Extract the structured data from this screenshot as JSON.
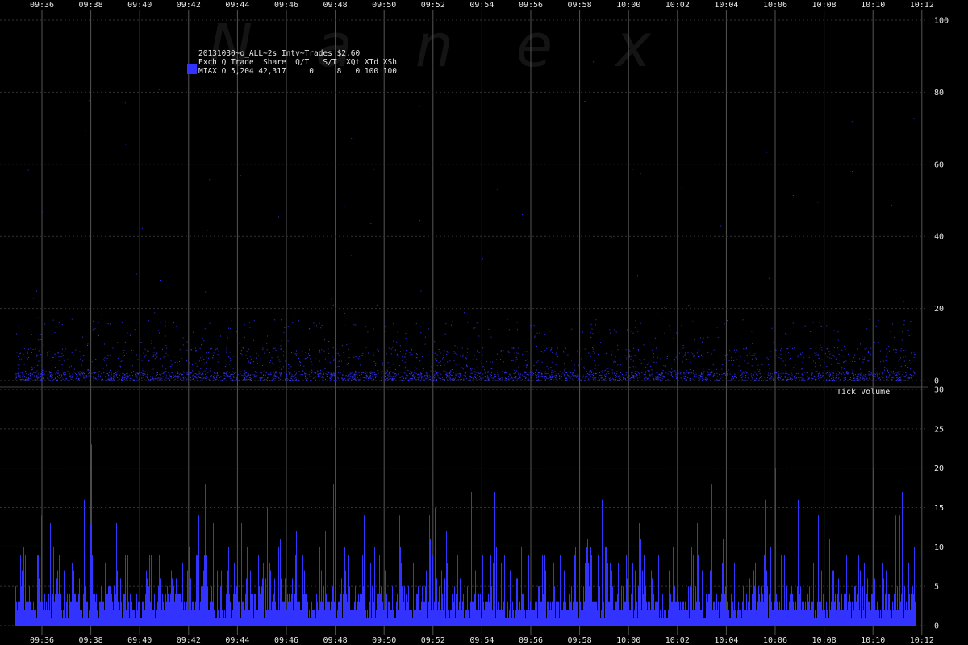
{
  "watermark": "Nanex",
  "legend": {
    "title": "20131030~o_ALL~2s Intv~Trades $2.60",
    "header": "Exch Q Trade  Share  Q/T   S/T  XQt XTd XSh",
    "row": "MIAX O 5,204 42,317     0     8   0 100 100",
    "swatch_color": "#3333ff"
  },
  "colors": {
    "background": "#000000",
    "series": "#3333ff",
    "grid_vertical": "#555555",
    "grid_horizontal": "#333333"
  },
  "chart_data": [
    {
      "type": "scatter",
      "name": "upper-panel",
      "x_ticks": [
        "09:36",
        "09:38",
        "09:40",
        "09:42",
        "09:44",
        "09:46",
        "09:48",
        "09:50",
        "09:52",
        "09:54",
        "09:56",
        "09:58",
        "10:00",
        "10:02",
        "10:04",
        "10:06",
        "10:08",
        "10:10",
        "10:12"
      ],
      "y_ticks": [
        0,
        20,
        40,
        60,
        80,
        100
      ],
      "ylim": [
        0,
        100
      ],
      "series": [
        {
          "color": "#3333ff",
          "profile": "dense points between 0 and ~15, sparse outliers up to ~90",
          "x_range": [
            "09:35:00",
            "10:12:00"
          ]
        }
      ]
    },
    {
      "type": "bar",
      "name": "lower-panel",
      "label": "Tick Volume",
      "x_ticks": [
        "09:36",
        "09:38",
        "09:40",
        "09:42",
        "09:44",
        "09:46",
        "09:48",
        "09:50",
        "09:52",
        "09:54",
        "09:56",
        "09:58",
        "10:00",
        "10:02",
        "10:04",
        "10:06",
        "10:08",
        "10:10",
        "10:12"
      ],
      "y_ticks": [
        0,
        5,
        10,
        15,
        20,
        25,
        30
      ],
      "ylim": [
        0,
        30
      ],
      "notable_values": [
        {
          "x": "09:38",
          "y": 23
        },
        {
          "x": "09:48",
          "y": 25
        },
        {
          "x": "10:06",
          "y": 20
        },
        {
          "x": "10:10",
          "y": 20
        }
      ]
    }
  ]
}
